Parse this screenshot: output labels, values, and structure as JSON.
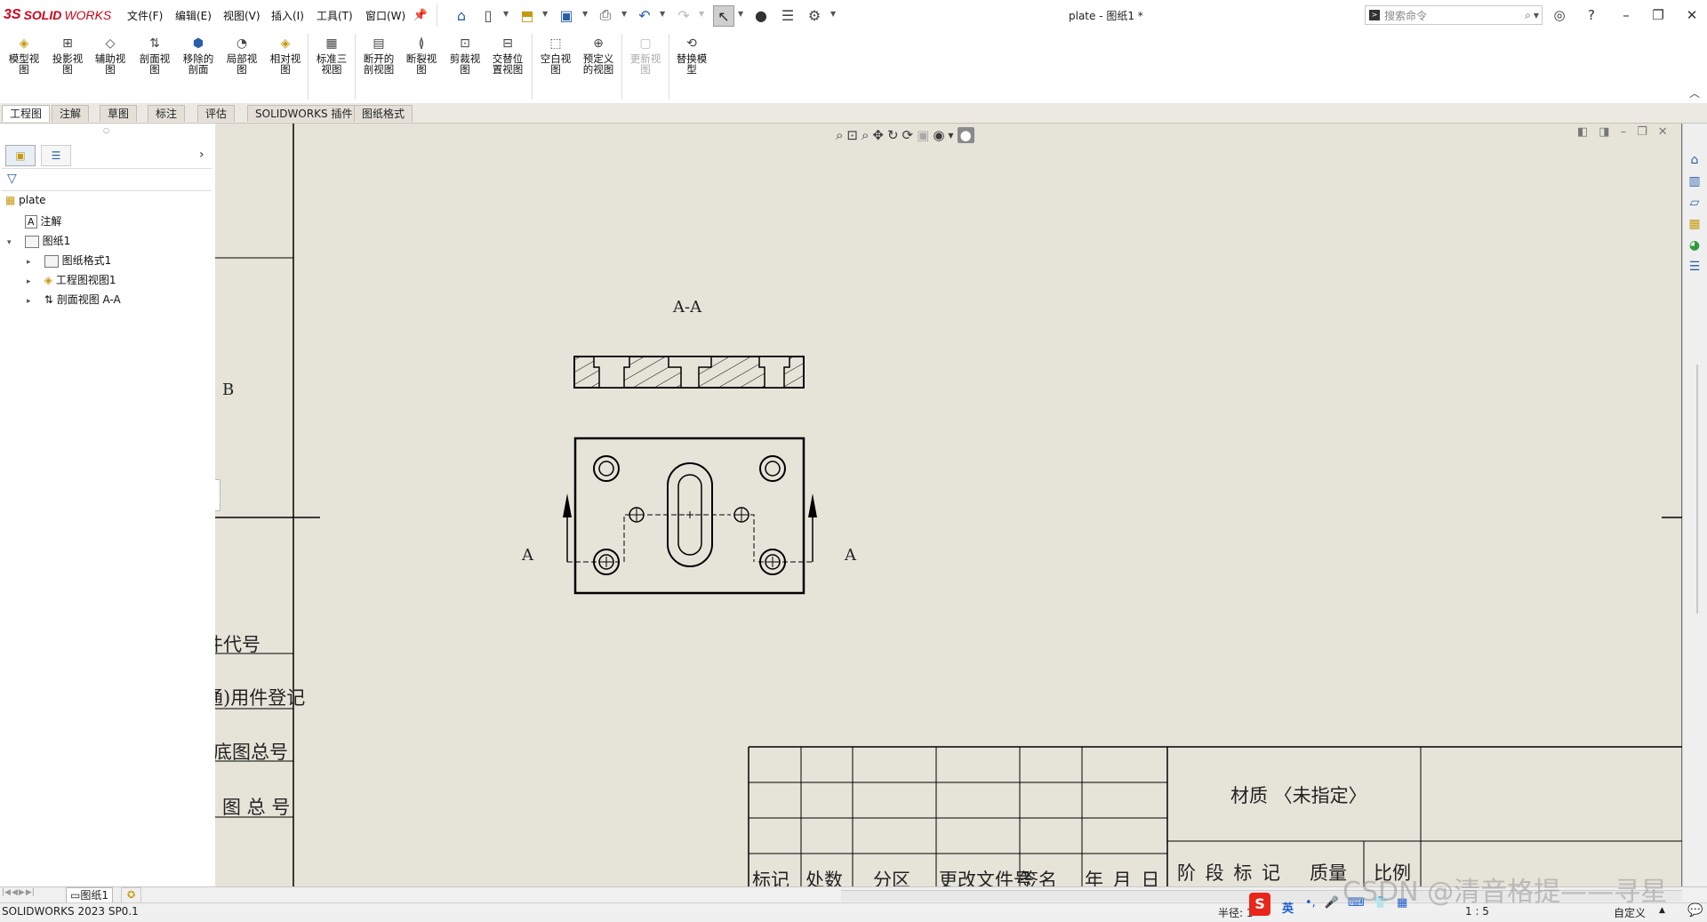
{
  "app": {
    "brand_prefix": "3S",
    "brand_solid": "SOLID",
    "brand_works": "WORKS"
  },
  "menu": [
    "文件(F)",
    "编辑(E)",
    "视图(V)",
    "插入(I)",
    "工具(T)",
    "窗口(W)"
  ],
  "document_title": "plate - 图纸1 *",
  "search": {
    "placeholder": "搜索命令"
  },
  "commands": [
    {
      "label": "模型视\n图"
    },
    {
      "label": "投影视\n图"
    },
    {
      "label": "辅助视\n图"
    },
    {
      "label": "剖面视\n图"
    },
    {
      "label": "移除的\n剖面"
    },
    {
      "label": "局部视\n图"
    },
    {
      "label": "相对视\n图"
    },
    {
      "label": "标准三\n视图"
    },
    {
      "label": "断开的\n剖视图"
    },
    {
      "label": "断裂视\n图"
    },
    {
      "label": "剪裁视\n图"
    },
    {
      "label": "交替位\n置视图"
    },
    {
      "label": "空白视\n图"
    },
    {
      "label": "预定义\n的视图"
    },
    {
      "label": "更新视\n图"
    },
    {
      "label": "替换模\n型"
    }
  ],
  "tabs": [
    "工程图",
    "注解",
    "草图",
    "标注",
    "评估",
    "SOLIDWORKS 插件",
    "图纸格式"
  ],
  "tree": {
    "root": "plate",
    "items": [
      "注解",
      "图纸1",
      "图纸格式1",
      "工程图视图1",
      "剖面视图 A-A"
    ]
  },
  "drawing": {
    "section_title": "A-A",
    "section_label_left": "A",
    "section_label_right": "A",
    "zone_label": "B",
    "left_block": [
      "件代号",
      "通)用件登记",
      "底图总号",
      "图 总 号"
    ],
    "title_block": {
      "material": "材质 〈未指定〉",
      "headers": [
        "标记",
        "处数",
        "分区",
        "更改文件号",
        "签名",
        "年 月 日"
      ],
      "stage_label": "阶 段 标 记",
      "mass_label": "质量",
      "scale_label": "比例"
    }
  },
  "sheet_tab": "图纸1",
  "status": {
    "version": "SOLIDWORKS 2023 SP0.1",
    "radius_label": "半径: 1",
    "ime_lang": "英",
    "scale": "1 : 5",
    "custom": "自定义",
    "watermark": "CSDN @清音格提——寻星"
  }
}
